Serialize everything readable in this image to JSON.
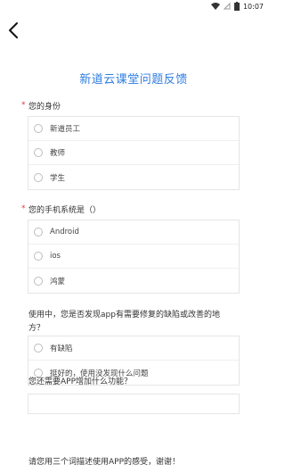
{
  "status": {
    "time": "10:07"
  },
  "page": {
    "title": "新道云课堂问题反馈"
  },
  "questions": [
    {
      "required": true,
      "star": "*",
      "label": "您的身份",
      "options": [
        "新道员工",
        "教师",
        "学生"
      ]
    },
    {
      "required": true,
      "star": "*",
      "label": "您的手机系统是（）",
      "options": [
        "Android",
        "ios",
        "鸿蒙"
      ]
    },
    {
      "required": false,
      "label_line1": "使用中，您是否发现app有需要修复的缺陷或改善的地",
      "label_line2": "方？",
      "options": [
        "有缺陷",
        "挺好的，使用没发现什么问题"
      ]
    },
    {
      "required": false,
      "label": "您还需要APP增加什么功能？",
      "value": "",
      "placeholder": ""
    },
    {
      "required": false,
      "label": "请您用三个词描述使用APP的感受，谢谢！"
    }
  ],
  "colors": {
    "title": "#2f7de1",
    "required": "#e53935"
  }
}
